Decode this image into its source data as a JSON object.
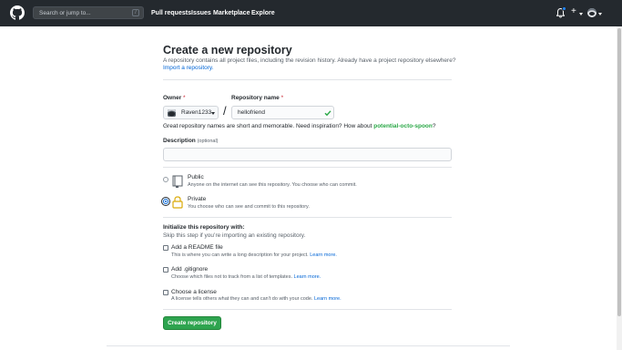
{
  "header": {
    "search_placeholder": "Search or jump to...",
    "search_shortcut": "/",
    "nav": [
      "Pull requests",
      "Issues",
      "Marketplace",
      "Explore"
    ],
    "plus_label": "+",
    "logo_icon": "github-mark-icon",
    "bell_icon": "bell-icon",
    "notification_dot_color": "#2188ff"
  },
  "page": {
    "title": "Create a new repository",
    "subhead": "A repository contains all project files, including the revision history. Already have a project repository elsewhere?",
    "import_link": "Import a repository."
  },
  "form": {
    "owner_label": "Owner",
    "repo_label": "Repository name",
    "required_mark": "*",
    "owner_value": "Raven1233",
    "separator": "/",
    "repo_value": "hellofriend",
    "hint_text": "Great repository names are short and memorable. Need inspiration? How about ",
    "hint_suggestion": "potential-octo-spoon",
    "hint_end": "?",
    "description_label": "Description",
    "description_optional": "(optional)",
    "description_value": "",
    "visibility": {
      "public_title": "Public",
      "public_desc": "Anyone on the internet can see this repository. You choose who can commit.",
      "private_title": "Private",
      "private_desc": "You choose who can see and commit to this repository.",
      "selected": "private"
    },
    "init": {
      "heading": "Initialize this repository with:",
      "sub": "Skip this step if you’re importing an existing repository.",
      "readme_title": "Add a README file",
      "readme_desc": "This is where you can write a long description for your project.",
      "gitignore_title": "Add .gitignore",
      "gitignore_desc": "Choose which files not to track from a list of templates.",
      "license_title": "Choose a license",
      "license_desc": "A license tells others what they can and can't do with your code.",
      "learn_more": "Learn more."
    },
    "submit_label": "Create repository"
  },
  "colors": {
    "header_bg": "#24292e",
    "link": "#0366d6",
    "success": "#28a745",
    "button_bg": "#2ea44f",
    "required": "#cb2431"
  }
}
